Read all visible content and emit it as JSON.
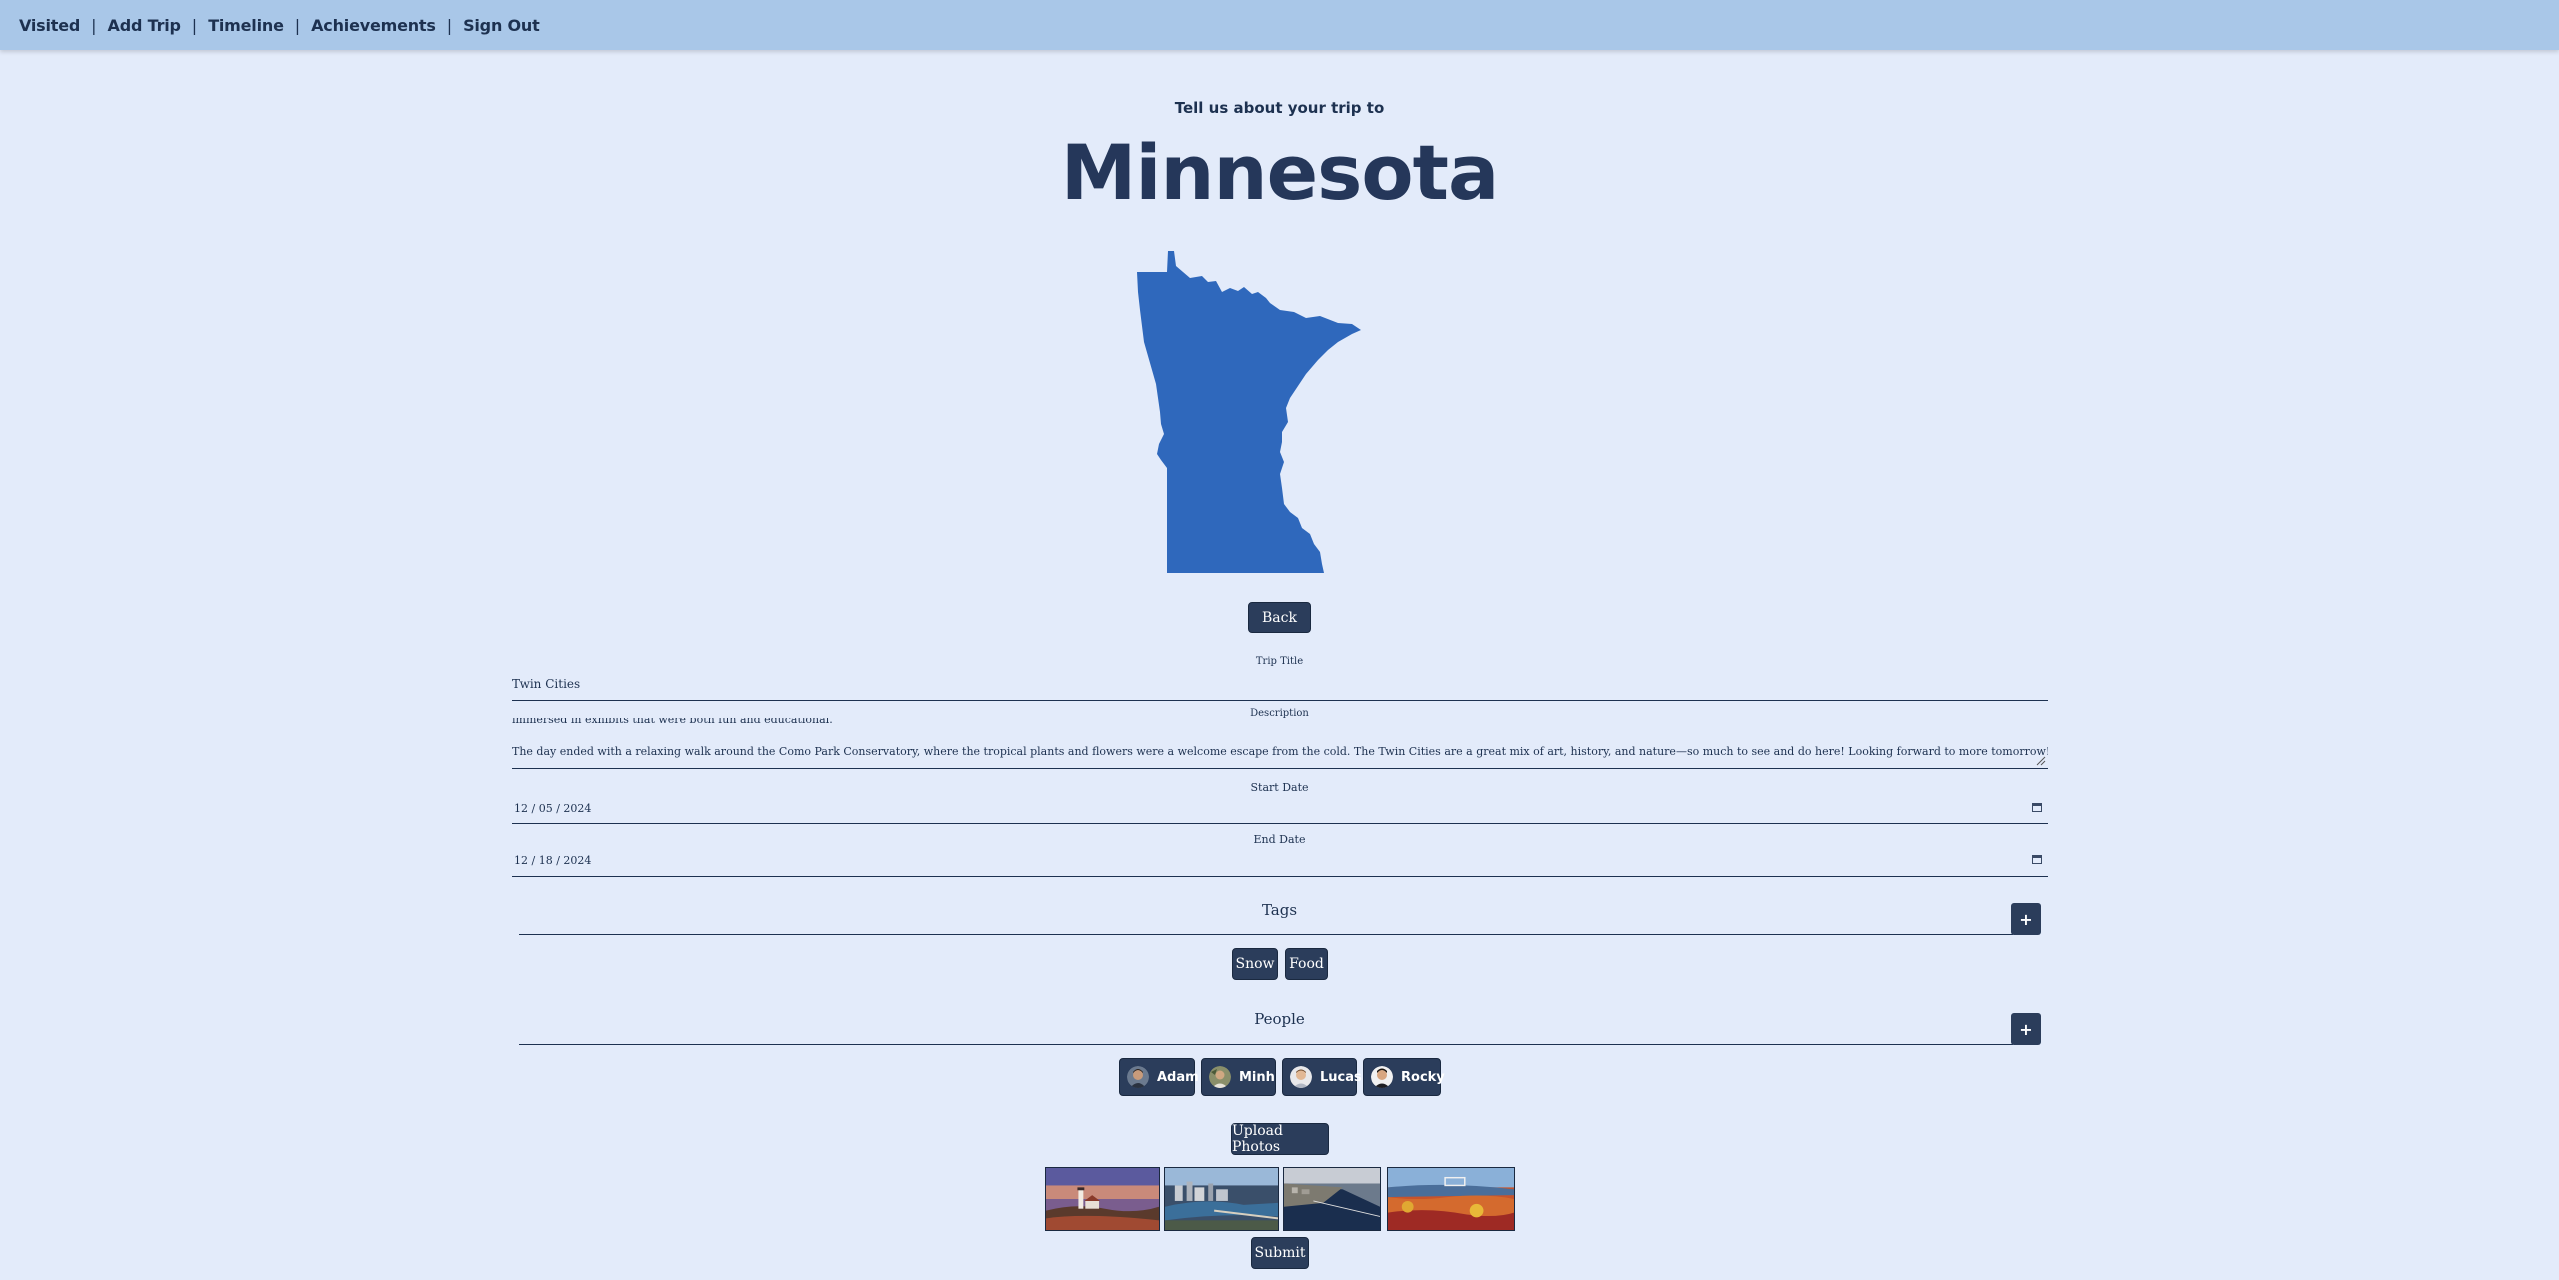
{
  "nav": {
    "items": [
      "Visited",
      "Add Trip",
      "Timeline",
      "Achievements",
      "Sign Out"
    ]
  },
  "header": {
    "subtitle": "Tell us about your trip to",
    "state_name": "Minnesota"
  },
  "buttons": {
    "back": "Back",
    "upload": "Upload Photos",
    "submit": "Submit",
    "add": "+"
  },
  "form": {
    "trip_title_label": "Trip Title",
    "trip_title_value": "Twin Cities",
    "description_label": "Description",
    "description_partial_line": "immersed in exhibits that were both fun and educational.",
    "description_last_line": "The day ended with a relaxing walk around the Como Park Conservatory, where the tropical plants and flowers were a welcome escape from the cold. The Twin Cities are a great mix of art, history, and nature—so much to see and do here! Looking forward to more tomorrow!",
    "start_date_label": "Start Date",
    "start_date_value": "12 / 05 / 2024",
    "end_date_label": "End Date",
    "end_date_value": "12 / 18 / 2024"
  },
  "tags": {
    "title": "Tags",
    "items": [
      "Snow",
      "Food"
    ]
  },
  "people": {
    "title": "People",
    "items": [
      "Adam",
      "Minh",
      "Lucas",
      "Rocky"
    ]
  },
  "photos": [
    "lighthouse-photo",
    "city-river-photo",
    "harbor-photo",
    "autumn-hills-photo"
  ],
  "colors": {
    "background": "#e3ebfa",
    "topbar": "#a9c7e8",
    "primary": "#2b3d5b",
    "text": "#1d3150",
    "map_fill": "#2f68bc"
  },
  "icons": {
    "calendar": "calendar-icon",
    "resize": "resize-handle-icon"
  }
}
